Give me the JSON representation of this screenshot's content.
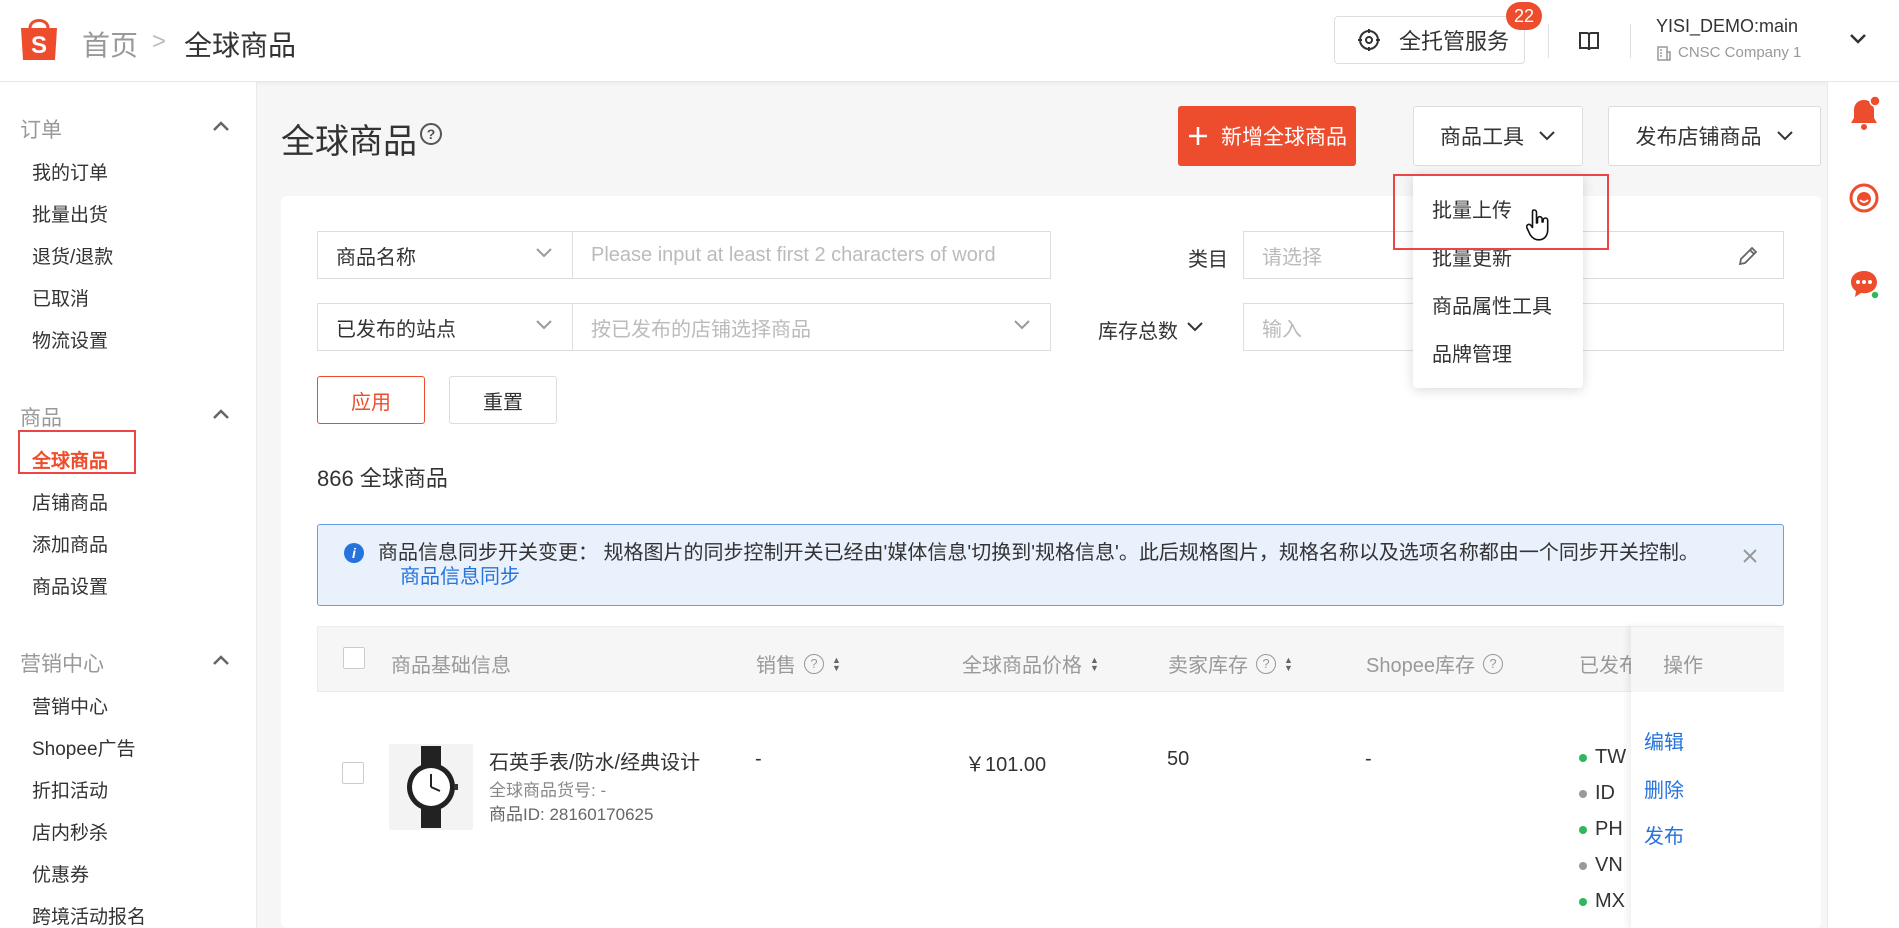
{
  "header": {
    "breadcrumb_home": "首页",
    "breadcrumb_sep": ">",
    "breadcrumb_current": "全球商品",
    "service_label": "全托管服务",
    "service_badge": "22",
    "account_name": "YISI_DEMO:main",
    "account_company": "CNSC Company 1"
  },
  "sidebar": {
    "sections": [
      {
        "title": "订单",
        "items": [
          "我的订单",
          "批量出货",
          "退货/退款",
          "已取消",
          "物流设置"
        ]
      },
      {
        "title": "商品",
        "items": [
          "全球商品",
          "店铺商品",
          "添加商品",
          "商品设置"
        ]
      },
      {
        "title": "营销中心",
        "items": [
          "营销中心",
          "Shopee广告",
          "折扣活动",
          "店内秒杀",
          "优惠券",
          "跨境活动报名"
        ]
      }
    ]
  },
  "main": {
    "title": "全球商品",
    "help_glyph": "?",
    "add_button": "新增全球商品",
    "tools_button": "商品工具",
    "publish_button": "发布店铺商品",
    "tools_menu": [
      "批量上传",
      "批量更新",
      "商品属性工具",
      "品牌管理"
    ],
    "filters": {
      "name_select": "商品名称",
      "name_placeholder": "Please input at least first 2 characters of word",
      "category_label": "类目",
      "category_placeholder": "请选择",
      "site_select": "已发布的站点",
      "site_placeholder": "按已发布的店铺选择商品",
      "stock_label": "库存总数",
      "stock_placeholder": "输入",
      "apply": "应用",
      "reset": "重置"
    },
    "count_text": "866 全球商品",
    "notice": {
      "text": "商品信息同步开关变更： 规格图片的同步控制开关已经由'媒体信息'切换到'规格信息'。此后规格图片，规格名称以及选项名称都由一个同步开关控制。",
      "link": "商品信息同步"
    },
    "table": {
      "columns": [
        "商品基础信息",
        "销售",
        "全球商品价格",
        "卖家库存",
        "Shopee库存",
        "已发布",
        "操作"
      ],
      "rows": [
        {
          "name": "石英手表/防水/经典设计",
          "sku": "全球商品货号: -",
          "id": "商品ID: 28160170625",
          "sales": "-",
          "price": "￥101.00",
          "seller_stock": "50",
          "shopee_stock": "-",
          "sites": [
            {
              "code": "TW",
              "status_color": "#2db85c"
            },
            {
              "code": "ID",
              "status_color": "#999999"
            },
            {
              "code": "PH",
              "status_color": "#2db85c"
            },
            {
              "code": "VN",
              "status_color": "#999999"
            },
            {
              "code": "MX",
              "status_color": "#2db85c"
            }
          ],
          "actions": [
            "编辑",
            "删除",
            "发布"
          ]
        }
      ]
    }
  },
  "colors": {
    "brand": "#ee4d2d",
    "link": "#2673dd",
    "notice_bg": "#e9f1fc"
  }
}
